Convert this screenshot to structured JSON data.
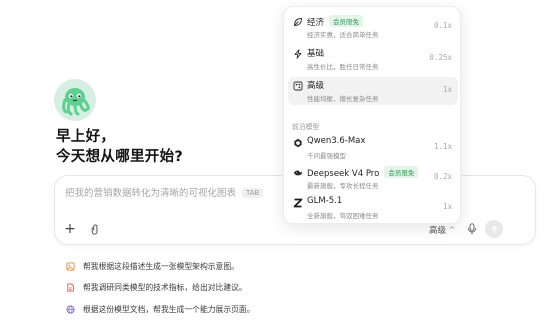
{
  "greeting": {
    "line1": "早上好，",
    "line2": "今天想从哪里开始?"
  },
  "composer": {
    "placeholder": "把我的营销数据转化为清晰的可视化图表",
    "tab_hint": "TAB",
    "mode_label": "高级",
    "mode_chevron": "^",
    "plus_label": "+"
  },
  "suggestions": [
    {
      "text": "帮我根据这段描述生成一张模型架构示意图。",
      "icon": "image-icon",
      "color": "#e8893a"
    },
    {
      "text": "帮我调研同类模型的技术指标，给出对比建议。",
      "icon": "document-icon",
      "color": "#e0533d"
    },
    {
      "text": "根据这份模型文档，帮我生成一个能力展示页面。",
      "icon": "globe-icon",
      "color": "#7a5fd6"
    }
  ],
  "dropdown": {
    "tiers": [
      {
        "name": "经济",
        "badge": "会员限免",
        "desc": "经济实惠，适合简单任务",
        "cost": "0.1x",
        "icon": "leaf-icon"
      },
      {
        "name": "基础",
        "badge": "",
        "desc": "高性价比，胜任日常任务",
        "cost": "0.25x",
        "icon": "bolt-icon"
      },
      {
        "name": "高级",
        "badge": "",
        "desc": "性能均衡，擅长复杂任务",
        "cost": "1x",
        "icon": "sparkle-grid-icon",
        "selected": true
      }
    ],
    "section_label": "前沿模型",
    "models": [
      {
        "name": "Qwen3.6-Max",
        "badge": "",
        "desc": "千问最强模型",
        "cost": "1.1x",
        "icon": "qwen-icon"
      },
      {
        "name": "Deepseek V4 Pro",
        "badge": "会员限免",
        "desc": "最新旗舰，专攻长程任务",
        "cost": "0.2x",
        "icon": "deepseek-whale-icon"
      },
      {
        "name": "GLM-5.1",
        "badge": "",
        "desc": "全新旗舰，驾驭困难任务",
        "cost": "1x",
        "icon": "zhipu-z-icon"
      }
    ]
  },
  "colors": {
    "badge_green": "#2e9a55",
    "avatar_green": "#5fcf8f",
    "selected_bg": "#f2f2f2"
  }
}
